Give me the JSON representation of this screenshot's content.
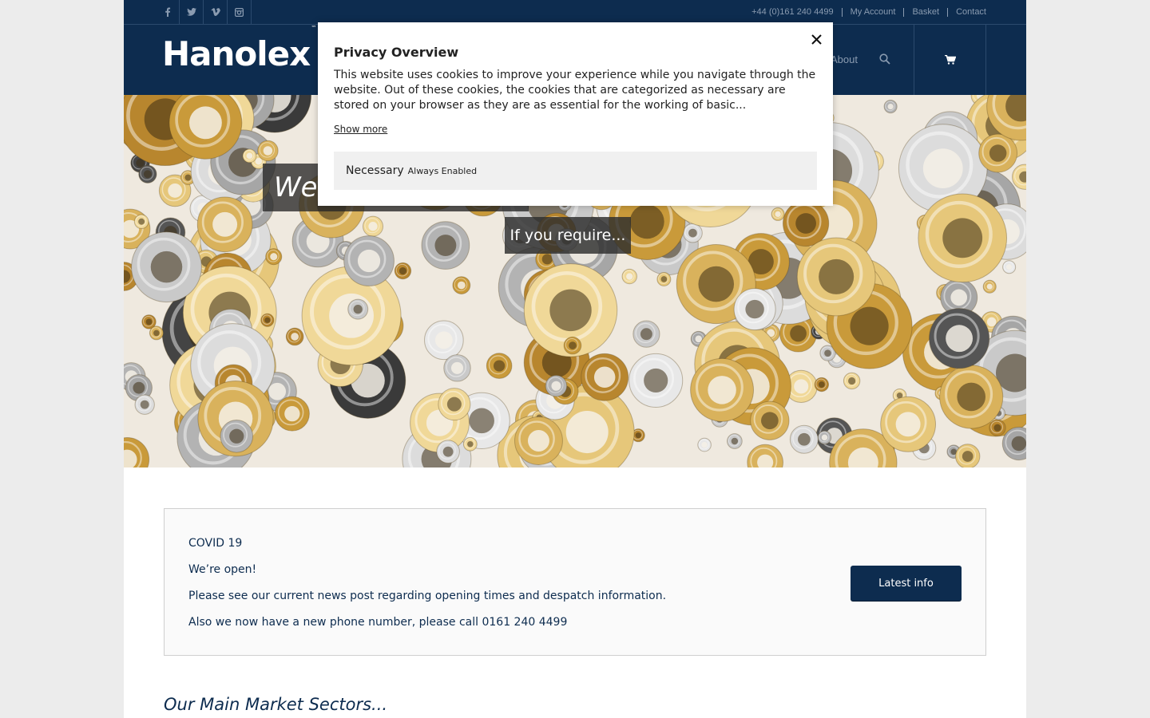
{
  "topbar": {
    "social_icons": [
      "facebook-icon",
      "twitter-icon",
      "vimeo-icon",
      "instagram-icon"
    ],
    "phone": "+44 (0)161 240 4499",
    "links": [
      "My Account",
      "Basket",
      "Contact"
    ]
  },
  "header": {
    "logo": "Hanolex",
    "logo_mark": "™",
    "nav_about": "About",
    "search_icon": "search-icon",
    "cart_icon": "cart-icon"
  },
  "hero": {
    "caption_welcome": "Welcome",
    "caption_require": "If you require..."
  },
  "covid": {
    "title": "COVID 19",
    "lines": [
      "We’re open!",
      "Please see our current news post regarding opening times and despatch information.",
      "Also we now have a new phone number, please call 0161 240 4499"
    ],
    "button": "Latest info"
  },
  "sectors_heading": "Our Main Market Sectors...",
  "privacy_modal": {
    "title": "Privacy Overview",
    "text": "This website uses cookies to improve your experience while you navigate through the website. Out of these cookies, the cookies that are categorized as necessary are stored on your browser as they are as essential for the working of basic...",
    "show_more": "Show more",
    "necessary_label": "Necessary",
    "necessary_status": "Always Enabled",
    "close_icon": "close-icon"
  },
  "colors": {
    "brand_navy": "#0d2c4f",
    "muted_link": "#8a9bb0",
    "panel_grey": "#f0f0f0"
  }
}
